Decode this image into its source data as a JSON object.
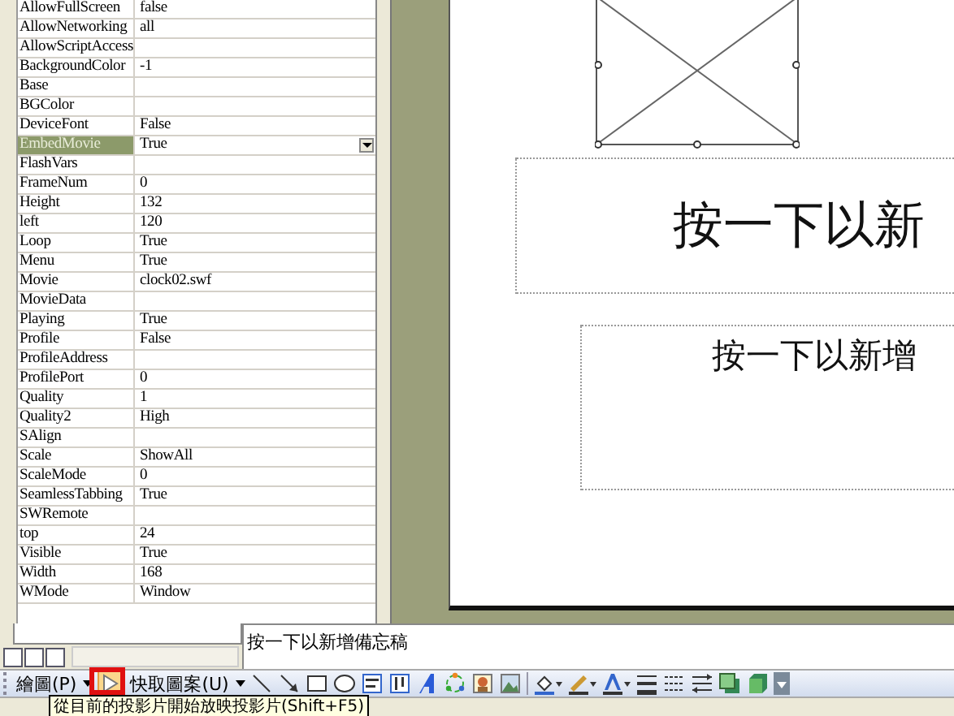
{
  "properties": [
    {
      "name": "AllowFullScreen",
      "value": "false",
      "selected": false
    },
    {
      "name": "AllowNetworking",
      "value": "all",
      "selected": false
    },
    {
      "name": "AllowScriptAccess",
      "selected": false
    },
    {
      "name": "BackgroundColor",
      "value": "-1",
      "selected": false
    },
    {
      "name": "Base",
      "selected": false
    },
    {
      "name": "BGColor",
      "selected": false
    },
    {
      "name": "DeviceFont",
      "value": "False",
      "selected": false
    },
    {
      "name": "EmbedMovie",
      "value": "True",
      "selected": true
    },
    {
      "name": "FlashVars",
      "selected": false
    },
    {
      "name": "FrameNum",
      "value": "0",
      "selected": false
    },
    {
      "name": "Height",
      "value": "132",
      "selected": false
    },
    {
      "name": "left",
      "value": "120",
      "selected": false
    },
    {
      "name": "Loop",
      "value": "True",
      "selected": false
    },
    {
      "name": "Menu",
      "value": "True",
      "selected": false
    },
    {
      "name": "Movie",
      "value": "clock02.swf",
      "selected": false
    },
    {
      "name": "MovieData",
      "selected": false
    },
    {
      "name": "Playing",
      "value": "True",
      "selected": false
    },
    {
      "name": "Profile",
      "value": "False",
      "selected": false
    },
    {
      "name": "ProfileAddress",
      "selected": false
    },
    {
      "name": "ProfilePort",
      "value": "0",
      "selected": false
    },
    {
      "name": "Quality",
      "value": "1",
      "selected": false
    },
    {
      "name": "Quality2",
      "value": "High",
      "selected": false
    },
    {
      "name": "SAlign",
      "selected": false
    },
    {
      "name": "Scale",
      "value": "ShowAll",
      "selected": false
    },
    {
      "name": "ScaleMode",
      "value": "0",
      "selected": false
    },
    {
      "name": "SeamlessTabbing",
      "value": "True",
      "selected": false
    },
    {
      "name": "SWRemote",
      "selected": false
    },
    {
      "name": "top",
      "value": "24",
      "selected": false
    },
    {
      "name": "Visible",
      "value": "True",
      "selected": false
    },
    {
      "name": "Width",
      "value": "168",
      "selected": false
    },
    {
      "name": "WMode",
      "value": "Window",
      "selected": false
    }
  ],
  "slide": {
    "title_placeholder": "按一下以新",
    "subtitle_placeholder": "按一下以新增"
  },
  "notes": {
    "placeholder": "按一下以新增備忘稿"
  },
  "drawing_toolbar": {
    "draw_menu": "繪圖(P)",
    "slideshow_button": {
      "highlighted": true
    },
    "autoshapes_menu": "快取圖案(U)"
  },
  "tooltip": {
    "text": "從目前的投影片開始放映投影片(Shift+F5)"
  }
}
